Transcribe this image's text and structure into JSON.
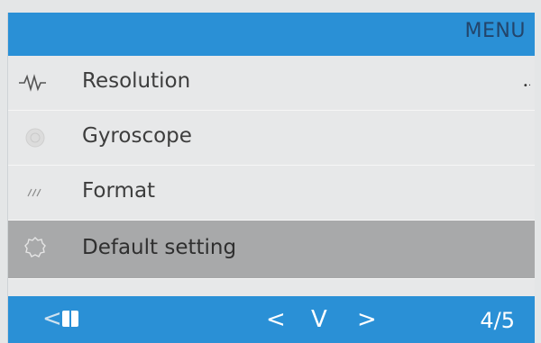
{
  "header": {
    "title": "MENU"
  },
  "menu": {
    "items": [
      {
        "label": "Resolution",
        "icon": "waveform-icon"
      },
      {
        "label": "Gyroscope",
        "icon": "gyroscope-icon"
      },
      {
        "label": "Format",
        "icon": "format-icon"
      },
      {
        "label": "Default setting",
        "icon": "gear-outline-icon",
        "selected": true
      }
    ]
  },
  "footer": {
    "back": "<",
    "nav_left": "<",
    "nav_down": "V",
    "nav_right": ">",
    "page": "4/5"
  },
  "colors": {
    "bar_blue": "#2a90d6",
    "selected_row": "#a8a9aa",
    "background": "#e7e8e9",
    "title_text": "#23456b"
  }
}
